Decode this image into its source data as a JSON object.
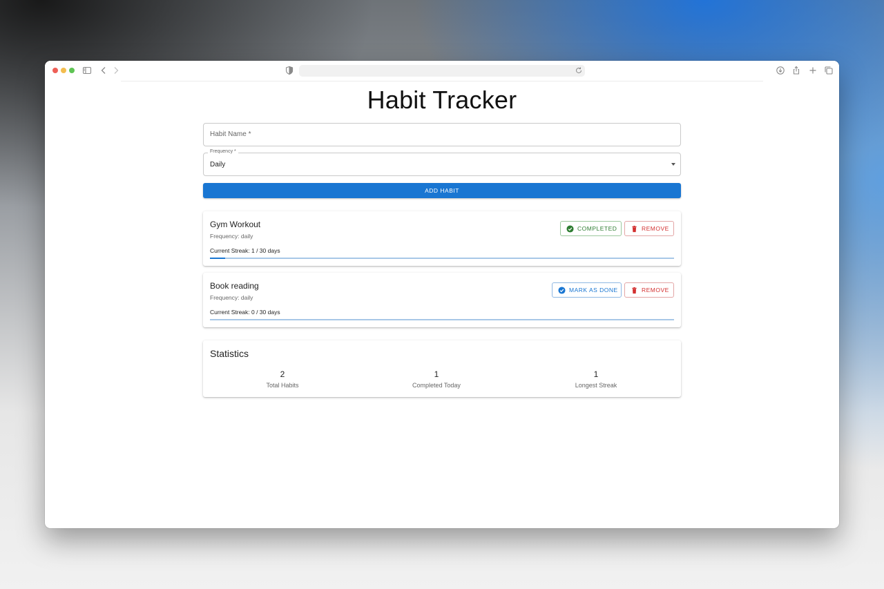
{
  "colors": {
    "primary": "#1976d2",
    "success": "#2e7d32",
    "error": "#d32f2f"
  },
  "page": {
    "title": "Habit Tracker"
  },
  "form": {
    "name_placeholder": "Habit Name *",
    "frequency_label": "Frequency *",
    "frequency_value": "Daily",
    "add_button": "ADD HABIT"
  },
  "habits": [
    {
      "name": "Gym Workout",
      "frequency": "Frequency: daily",
      "streak_text": "Current Streak: 1 / 30 days",
      "progress_fraction": 0.0333,
      "action_label": "COMPLETED",
      "action_icon": "check-circle-icon",
      "remove_label": "REMOVE",
      "remove_icon": "trash-icon"
    },
    {
      "name": "Book reading",
      "frequency": "Frequency: daily",
      "streak_text": "Current Streak: 0 / 30 days",
      "progress_fraction": 0,
      "action_label": "MARK AS DONE",
      "action_icon": "check-circle-icon",
      "remove_label": "REMOVE",
      "remove_icon": "trash-icon"
    }
  ],
  "statistics": {
    "title": "Statistics",
    "items": [
      {
        "value": "2",
        "label": "Total Habits"
      },
      {
        "value": "1",
        "label": "Completed Today"
      },
      {
        "value": "1",
        "label": "Longest Streak"
      }
    ]
  }
}
